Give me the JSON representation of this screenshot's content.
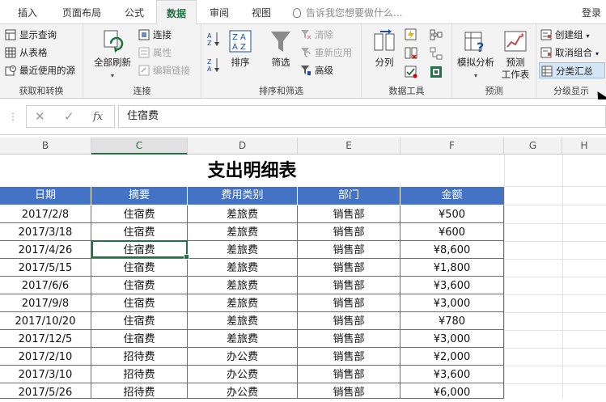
{
  "tabs": [
    {
      "label": "插入",
      "left": 0
    },
    {
      "label": "页面布局"
    },
    {
      "label": "公式"
    },
    {
      "label": "数据"
    },
    {
      "label": "审阅"
    },
    {
      "label": "视图"
    }
  ],
  "tell_me": "告诉我您想要做什么...",
  "login": "登录",
  "ribbon": {
    "get_transform": {
      "show_queries": "显示查询",
      "from_table": "从表格",
      "recent_sources": "最近使用的源",
      "group_label": "获取和转换"
    },
    "connections": {
      "refresh_all": "全部刷新",
      "connections": "连接",
      "properties": "属性",
      "edit_links": "编辑链接",
      "group_label": "连接"
    },
    "sort_filter": {
      "sort": "排序",
      "filter": "筛选",
      "clear": "清除",
      "reapply": "重新应用",
      "advanced": "高级",
      "group_label": "排序和筛选"
    },
    "data_tools": {
      "text_to_columns": "分列",
      "group_label": "数据工具"
    },
    "forecast": {
      "what_if": "模拟分析",
      "forecast_sheet": "预测\n工作表",
      "forecast_sheet_line1": "预测",
      "forecast_sheet_line2": "工作表",
      "group_label": "预测"
    },
    "outline": {
      "group": "创建组",
      "ungroup": "取消组合",
      "subtotal": "分类汇总",
      "group_label": "分级显示"
    }
  },
  "formula_bar": {
    "cancel_symbol": "✕",
    "enter_symbol": "✓",
    "fx_symbol": "fx",
    "value": "住宿费"
  },
  "columns": [
    "B",
    "C",
    "D",
    "E",
    "F",
    "G",
    "H"
  ],
  "sheet": {
    "title": "支出明细表",
    "headers": [
      "日期",
      "摘要",
      "费用类别",
      "部门",
      "金额"
    ],
    "rows": [
      [
        "2017/2/8",
        "住宿费",
        "差旅费",
        "销售部",
        "¥500"
      ],
      [
        "2017/3/18",
        "住宿费",
        "差旅费",
        "销售部",
        "¥600"
      ],
      [
        "2017/4/26",
        "住宿费",
        "差旅费",
        "销售部",
        "¥8,600"
      ],
      [
        "2017/5/15",
        "住宿费",
        "差旅费",
        "销售部",
        "¥1,800"
      ],
      [
        "2017/6/6",
        "住宿费",
        "差旅费",
        "销售部",
        "¥3,600"
      ],
      [
        "2017/9/8",
        "住宿费",
        "差旅费",
        "销售部",
        "¥3,000"
      ],
      [
        "2017/10/20",
        "住宿费",
        "差旅费",
        "销售部",
        "¥780"
      ],
      [
        "2017/12/5",
        "住宿费",
        "差旅费",
        "销售部",
        "¥3,000"
      ],
      [
        "2017/2/10",
        "招待费",
        "办公费",
        "销售部",
        "¥2,000"
      ],
      [
        "2017/3/10",
        "招待费",
        "办公费",
        "销售部",
        "¥3,600"
      ],
      [
        "2017/5/26",
        "招待费",
        "办公费",
        "销售部",
        "¥6,000"
      ]
    ]
  },
  "colors": {
    "accent": "#217346",
    "header_fill": "#4472c4"
  }
}
